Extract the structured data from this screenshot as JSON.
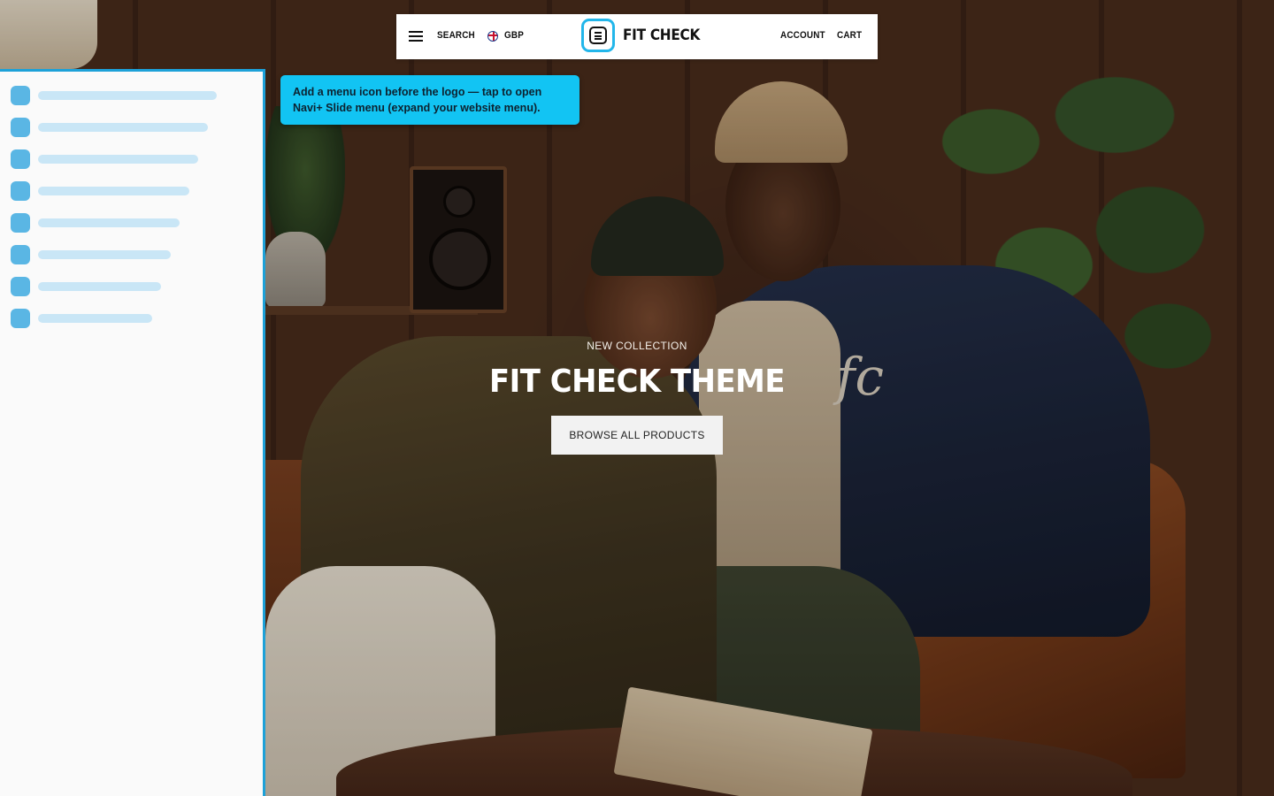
{
  "header": {
    "search_label": "SEARCH",
    "currency_label": "GBP",
    "brand": "FIT CHECK",
    "account_label": "ACCOUNT",
    "cart_label": "CART"
  },
  "tooltip": {
    "text": "Add a menu icon before the logo — tap to open Navi+ Slide menu (expand your website menu)."
  },
  "hero": {
    "eyebrow": "NEW COLLECTION",
    "title": "FIT CHECK THEME",
    "cta_label": "BROWSE ALL PRODUCTS",
    "jacket_monogram": "fc"
  },
  "slide_menu_preview": {
    "item_count": 8
  },
  "colors": {
    "accent": "#12c4f3",
    "panel_border": "#1da1d8",
    "placeholder_icon": "#5ab6e4",
    "placeholder_bar": "#c9e6f6"
  },
  "icons": [
    "hamburger-menu-icon",
    "uk-flag-icon",
    "navi-menu-icon"
  ]
}
